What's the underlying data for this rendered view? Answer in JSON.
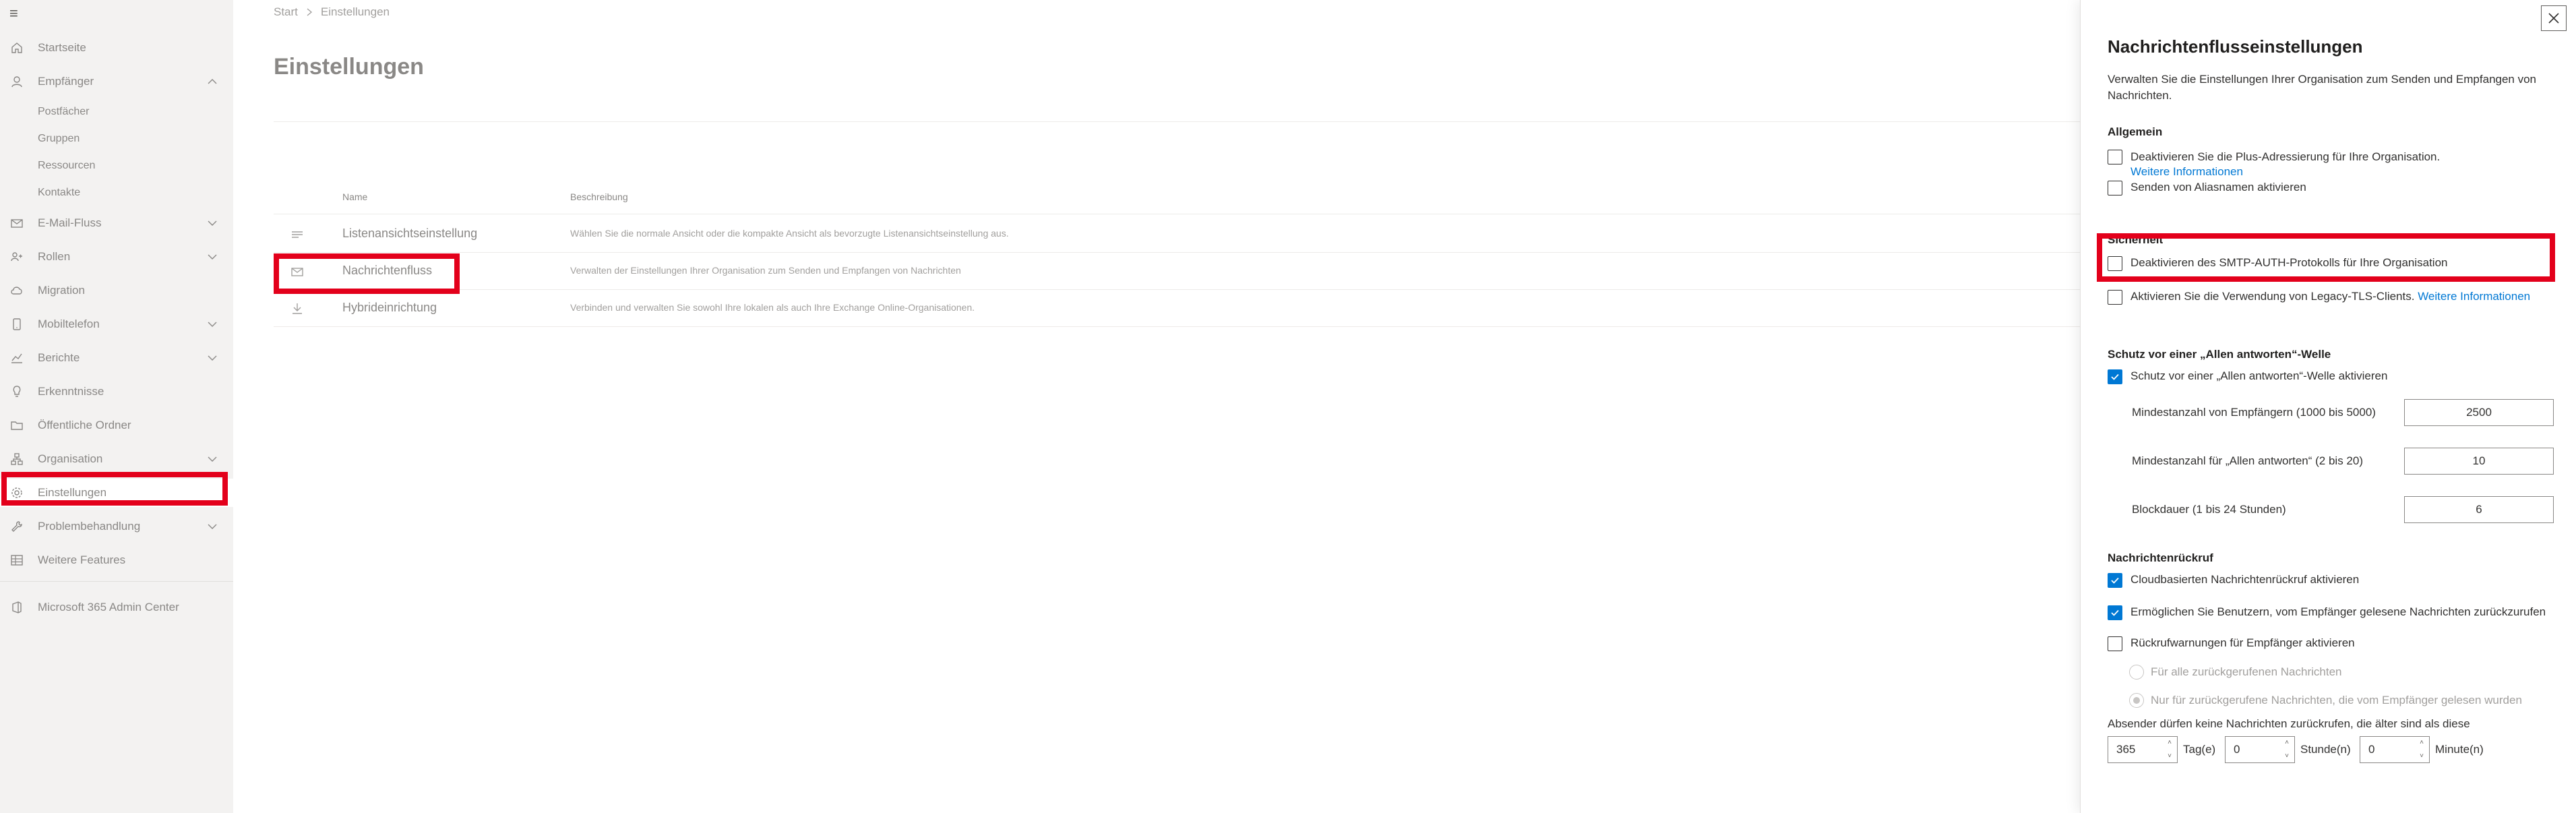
{
  "nav": {
    "items": [
      {
        "label": "Startseite",
        "icon": "home-icon"
      },
      {
        "label": "Empfänger",
        "icon": "person-icon",
        "chevron": "up"
      },
      {
        "label": "E-Mail-Fluss",
        "icon": "mail-icon",
        "chevron": "down"
      },
      {
        "label": "Rollen",
        "icon": "roles-icon",
        "chevron": "down"
      },
      {
        "label": "Migration",
        "icon": "cloud-upload-icon"
      },
      {
        "label": "Mobiltelefon",
        "icon": "phone-icon",
        "chevron": "down"
      },
      {
        "label": "Berichte",
        "icon": "chart-icon",
        "chevron": "down"
      },
      {
        "label": "Erkenntnisse",
        "icon": "lightbulb-icon"
      },
      {
        "label": "Öffentliche Ordner",
        "icon": "folder-icon"
      },
      {
        "label": "Organisation",
        "icon": "org-icon",
        "chevron": "down"
      },
      {
        "label": "Einstellungen",
        "icon": "gear-icon"
      },
      {
        "label": "Problembehandlung",
        "icon": "wrench-icon",
        "chevron": "down"
      },
      {
        "label": "Weitere Features",
        "icon": "grid-icon"
      },
      {
        "label": "Microsoft 365 Admin Center",
        "icon": "office-icon"
      }
    ],
    "sub_items": [
      "Postfächer",
      "Gruppen",
      "Ressourcen",
      "Kontakte"
    ]
  },
  "main": {
    "breadcrumb": [
      "Start",
      "Einstellungen"
    ],
    "title": "Einstellungen",
    "columns": {
      "name": "Name",
      "description": "Beschreibung"
    },
    "rows": [
      {
        "name": "Listenansichtseinstellung",
        "description": "Wählen Sie die normale Ansicht oder die kompakte Ansicht als bevorzugte Listenansichtseinstellung aus.",
        "icon": "list-icon"
      },
      {
        "name": "Nachrichtenfluss",
        "description": "Verwalten der Einstellungen Ihrer Organisation zum Senden und Empfangen von Nachrichten",
        "icon": "mail-icon"
      },
      {
        "name": "Hybrideinrichtung",
        "description": "Verbinden und verwalten Sie sowohl Ihre lokalen als auch Ihre Exchange Online-Organisationen.",
        "icon": "download-icon"
      }
    ]
  },
  "panel": {
    "title": "Nachrichtenflusseinstellungen",
    "description": "Verwalten Sie die Einstellungen Ihrer Organisation zum Senden und Empfangen von Nachrichten.",
    "sections": {
      "general": "Allgemein",
      "security": "Sicherheit",
      "replyall": "Schutz vor einer „Allen antworten“-Welle",
      "recall": "Nachrichtenrückruf"
    },
    "general": {
      "plus_addressing": "Deaktivieren Sie die Plus-Adressierung für Ihre Organisation.",
      "plus_link": "Weitere Informationen",
      "alias_sending": "Senden von Aliasnamen aktivieren"
    },
    "security": {
      "smtp_auth": "Deaktivieren des SMTP-AUTH-Protokolls für Ihre Organisation",
      "legacy_tls": "Aktivieren Sie die Verwendung von Legacy-TLS-Clients.",
      "legacy_link": "Weitere Informationen"
    },
    "replyall": {
      "enable": "Schutz vor einer „Allen antworten“-Welle aktivieren",
      "min_recipients_label": "Mindestanzahl von Empfängern (1000 bis 5000)",
      "min_recipients_value": "2500",
      "min_replies_label": "Mindestanzahl für „Allen antworten“ (2 bis 20)",
      "min_replies_value": "10",
      "block_label": "Blockdauer (1 bis 24 Stunden)",
      "block_value": "6"
    },
    "recall": {
      "cloud_recall": "Cloudbasierten Nachrichtenrückruf aktivieren",
      "read_recall": "Ermöglichen Sie Benutzern, vom Empfänger gelesene Nachrichten zurückzurufen",
      "warnings": "Rückrufwarnungen für Empfänger aktivieren",
      "radio_all": "Für alle zurückgerufenen Nachrichten",
      "radio_read": "Nur für zurückgerufene Nachrichten, die vom Empfänger gelesen wurden",
      "age_text": "Absender dürfen keine Nachrichten zurückrufen, die älter sind als diese",
      "days_value": "365",
      "days_label": "Tag(e)",
      "hours_value": "0",
      "hours_label": "Stunde(n)",
      "minutes_value": "0",
      "minutes_label": "Minute(n)"
    }
  },
  "colors": {
    "highlight": "#e3001b",
    "accent": "#0078d4"
  }
}
